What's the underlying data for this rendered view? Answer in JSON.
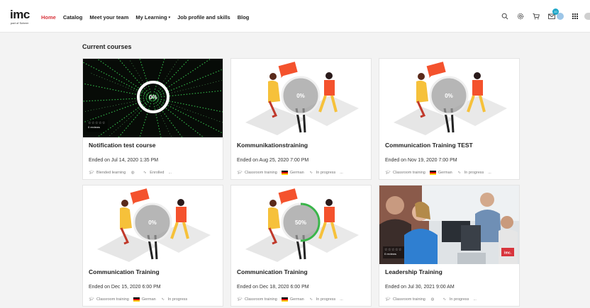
{
  "brand": {
    "logo_main": "imc",
    "logo_sub": "part of Scheer"
  },
  "nav": {
    "items": [
      "Home",
      "Catalog",
      "Meet your team",
      "My Learning",
      "Job profile and skills",
      "Blog"
    ],
    "caret": "▾"
  },
  "header_icons": {
    "badge_count": "10"
  },
  "section_title": "Current courses",
  "courses": [
    {
      "title": "Notification test course",
      "date": "Ended on Jul 14, 2020 1:35 PM",
      "progress": "0%",
      "stars": "☆☆☆☆☆",
      "reviews": "0 reviews",
      "type": "Blended learning",
      "status": "Enrolled",
      "more": "..."
    },
    {
      "title": "Kommunikationstraining",
      "date": "Ended on Aug 25, 2020 7:00 PM",
      "progress": "0%",
      "type": "Classroom training",
      "language": "German",
      "status": "In progress",
      "more": "..."
    },
    {
      "title": "Communication Training TEST",
      "date": "Ended on Nov 19, 2020 7:00 PM",
      "progress": "0%",
      "type": "Classroom training",
      "language": "German",
      "status": "In progress",
      "more": "..."
    },
    {
      "title": "Communication Training",
      "date": "Ended on Dec 15, 2020 6:00 PM",
      "progress": "0%",
      "type": "Classroom training",
      "language": "German",
      "status": "In progress",
      "more": "..."
    },
    {
      "title": "Communication Training",
      "date": "Ended on Dec 18, 2020 6:00 PM",
      "progress": "50%",
      "progress_value": 50,
      "type": "Classroom training",
      "language": "German",
      "status": "In progress",
      "more": "..."
    },
    {
      "title": "Leadership Training",
      "date": "Ended on Jul 30, 2021 9:00 AM",
      "stars": "☆☆☆☆☆",
      "reviews": "0 reviews",
      "type": "Classroom training",
      "status": "In progress",
      "more": "...",
      "watermark": "imc."
    }
  ],
  "colors": {
    "accent": "#d8343c",
    "progress_green": "#3ab54a",
    "badge": "#1fa7c9",
    "illus_orange": "#f4522d",
    "illus_yellow": "#f6c13a"
  }
}
